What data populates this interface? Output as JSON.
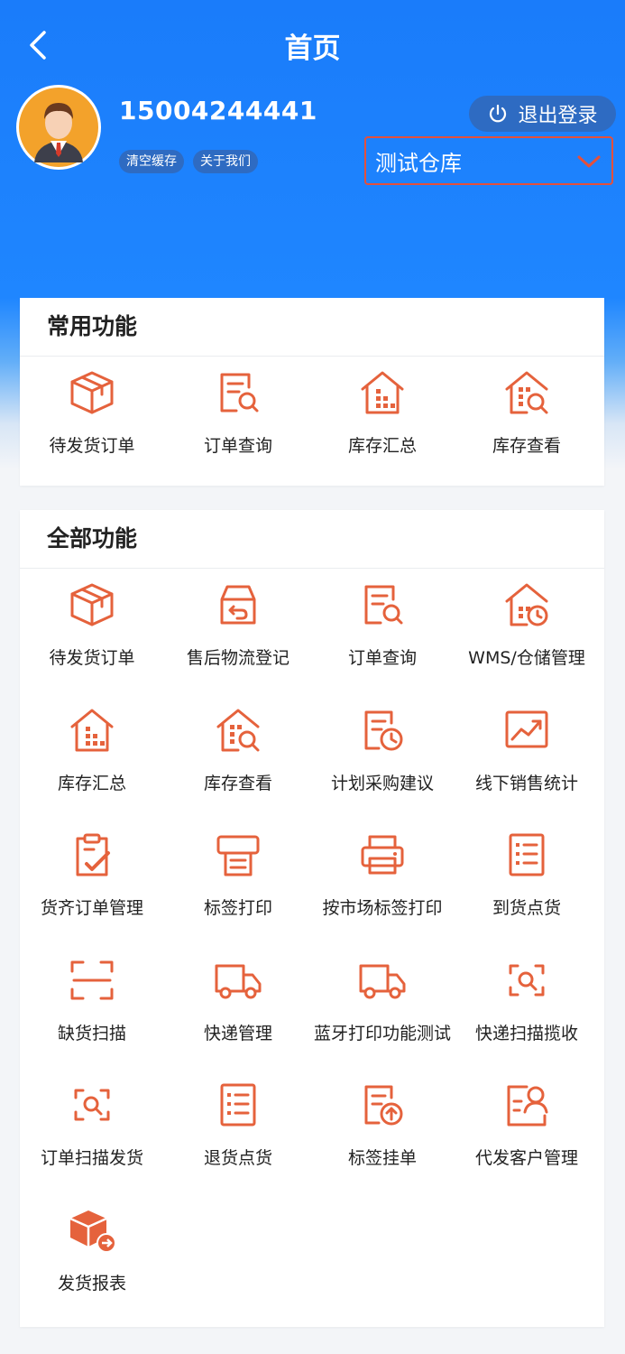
{
  "header": {
    "title": "首页",
    "phone": "15004244441",
    "clear_cache": "清空缓存",
    "about_us": "关于我们",
    "logout": "退出登录",
    "warehouse": "测试仓库",
    "accent": "#1f86ff",
    "icon_color": "#e5623c"
  },
  "common": {
    "title": "常用功能",
    "items": [
      {
        "label": "待发货订单",
        "icon": "package-icon"
      },
      {
        "label": "订单查询",
        "icon": "document-search-icon"
      },
      {
        "label": "库存汇总",
        "icon": "warehouse-icon"
      },
      {
        "label": "库存查看",
        "icon": "warehouse-search-icon"
      }
    ]
  },
  "all": {
    "title": "全部功能",
    "items": [
      {
        "label": "待发货订单",
        "icon": "package-icon"
      },
      {
        "label": "售后物流登记",
        "icon": "return-box-icon"
      },
      {
        "label": "订单查询",
        "icon": "document-search-icon"
      },
      {
        "label": "WMS/仓储管理",
        "icon": "warehouse-clock-icon"
      },
      {
        "label": "库存汇总",
        "icon": "warehouse-icon"
      },
      {
        "label": "库存查看",
        "icon": "warehouse-search-icon"
      },
      {
        "label": "计划采购建议",
        "icon": "document-clock-icon"
      },
      {
        "label": "线下销售统计",
        "icon": "trend-chart-icon"
      },
      {
        "label": "货齐订单管理",
        "icon": "clipboard-check-icon"
      },
      {
        "label": "标签打印",
        "icon": "label-printer-icon"
      },
      {
        "label": "按市场标签打印",
        "icon": "printer-icon"
      },
      {
        "label": "到货点货",
        "icon": "checklist-icon"
      },
      {
        "label": "缺货扫描",
        "icon": "scan-frame-icon"
      },
      {
        "label": "快递管理",
        "icon": "truck-icon"
      },
      {
        "label": "蓝牙打印功能测试",
        "icon": "truck-icon"
      },
      {
        "label": "快递扫描揽收",
        "icon": "scan-search-icon"
      },
      {
        "label": "订单扫描发货",
        "icon": "scan-search-icon"
      },
      {
        "label": "退货点货",
        "icon": "checklist-icon"
      },
      {
        "label": "标签挂单",
        "icon": "document-upload-icon"
      },
      {
        "label": "代发客户管理",
        "icon": "customer-card-icon"
      },
      {
        "label": "发货报表",
        "icon": "package-arrow-icon"
      }
    ]
  }
}
